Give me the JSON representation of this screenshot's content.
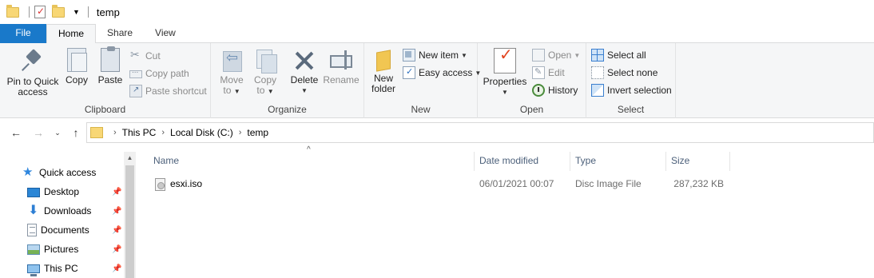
{
  "window": {
    "title": "temp"
  },
  "tabs": [
    "File",
    "Home",
    "Share",
    "View"
  ],
  "ribbon": {
    "clipboard": {
      "label": "Clipboard",
      "pin_line1": "Pin to Quick",
      "pin_line2": "access",
      "copy": "Copy",
      "paste": "Paste",
      "cut": "Cut",
      "copy_path": "Copy path",
      "paste_shortcut": "Paste shortcut"
    },
    "organize": {
      "label": "Organize",
      "move_to_1": "Move",
      "move_to_2": "to",
      "copy_to_1": "Copy",
      "copy_to_2": "to",
      "delete": "Delete",
      "rename": "Rename"
    },
    "new": {
      "label": "New",
      "new_folder_1": "New",
      "new_folder_2": "folder",
      "new_item": "New item",
      "easy_access": "Easy access"
    },
    "open": {
      "label": "Open",
      "properties": "Properties",
      "open": "Open",
      "edit": "Edit",
      "history": "History"
    },
    "select": {
      "label": "Select",
      "select_all": "Select all",
      "select_none": "Select none",
      "invert_selection": "Invert selection"
    }
  },
  "address": {
    "crumbs": [
      "This PC",
      "Local Disk (C:)",
      "temp"
    ]
  },
  "nav_pane": {
    "items": [
      "Quick access",
      "Desktop",
      "Downloads",
      "Documents",
      "Pictures",
      "This PC"
    ]
  },
  "file_list": {
    "columns": [
      "Name",
      "Date modified",
      "Type",
      "Size"
    ],
    "rows": [
      {
        "name": "esxi.iso",
        "date_modified": "06/01/2021 00:07",
        "type": "Disc Image File",
        "size": "287,232 KB"
      }
    ]
  },
  "colors": {
    "file_tab": "#1979ca",
    "ribbon_bg": "#f5f6f7",
    "column_header_text": "#4c607a",
    "accent_blue": "#2e86de"
  },
  "icons": [
    "folder-icon",
    "properties-icon",
    "pin-icon",
    "copy-icon",
    "paste-icon",
    "cut-icon",
    "copy-path-icon",
    "paste-shortcut-icon",
    "move-to-icon",
    "copy-to-icon",
    "delete-icon",
    "rename-icon",
    "new-folder-icon",
    "new-item-icon",
    "easy-access-icon",
    "open-icon",
    "edit-icon",
    "history-icon",
    "select-all-icon",
    "select-none-icon",
    "invert-selection-icon",
    "back-arrow-icon",
    "forward-arrow-icon",
    "recent-dropdown-icon",
    "up-arrow-icon",
    "star-icon",
    "desktop-icon",
    "download-icon",
    "documents-icon",
    "pictures-icon",
    "computer-icon",
    "disc-image-icon"
  ]
}
